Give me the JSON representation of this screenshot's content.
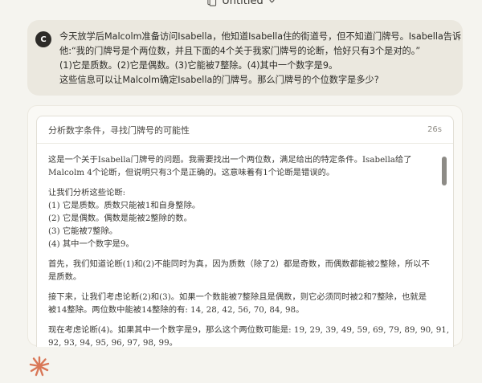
{
  "window": {
    "title": "Untitled"
  },
  "user": {
    "avatar_letter": "C",
    "lines": [
      "今天放学后Malcolm准备访问Isabella，他知道Isabella住的街道号，但不知道门牌号。Isabella告诉",
      "他:“我的门牌号是个两位数，并且下面的4个关于我家门牌号的论断，恰好只有3个是对的。”",
      "(1)它是质数。(2)它是偶数。(3)它能被7整除。(4)其中一个数字是9。",
      "这些信息可以让Malcolm确定Isabella的门牌号。那么门牌号的个位数字是多少?"
    ]
  },
  "thinking": {
    "title": "分析数字条件，寻找门牌号的可能性",
    "elapsed": "26s",
    "paragraphs": [
      [
        "这是一个关于Isabella门牌号的问题。我需要找出一个两位数，满足给出的特定条件。Isabella给了",
        "Malcolm 4个论断，但说明只有3个是正确的。这意味着有1个论断是错误的。"
      ],
      [
        "让我们分析这些论断:",
        "(1) 它是质数。质数只能被1和自身整除。",
        "(2) 它是偶数。偶数是能被2整除的数。",
        "(3) 它能被7整除。",
        "(4) 其中一个数字是9。"
      ],
      [
        "首先，我们知道论断(1)和(2)不能同时为真，因为质数（除了2）都是奇数，而偶数都能被2整除，所以不",
        "是质数。"
      ],
      [
        "接下来，让我们考虑论断(2)和(3)。如果一个数能被7整除且是偶数，则它必须同时被2和7整除，也就是",
        "被14整除。两位数中能被14整除的有: 14, 28, 42, 56, 70, 84, 98。"
      ],
      [
        "现在考虑论断(4)。如果其中一个数字是9，那么这个两位数可能是: 19, 29, 39, 49, 59, 69, 79, 89, 90, 91,",
        "92, 93, 94, 95, 96, 97, 98, 99。"
      ]
    ]
  },
  "icons": {
    "doc": "document-icon",
    "chevron": "chevron-down-icon",
    "logo": "claude-sparkle-icon"
  },
  "colors": {
    "accent": "#d97757",
    "background": "#f5f4ef",
    "user_bubble": "#ebe8df"
  }
}
